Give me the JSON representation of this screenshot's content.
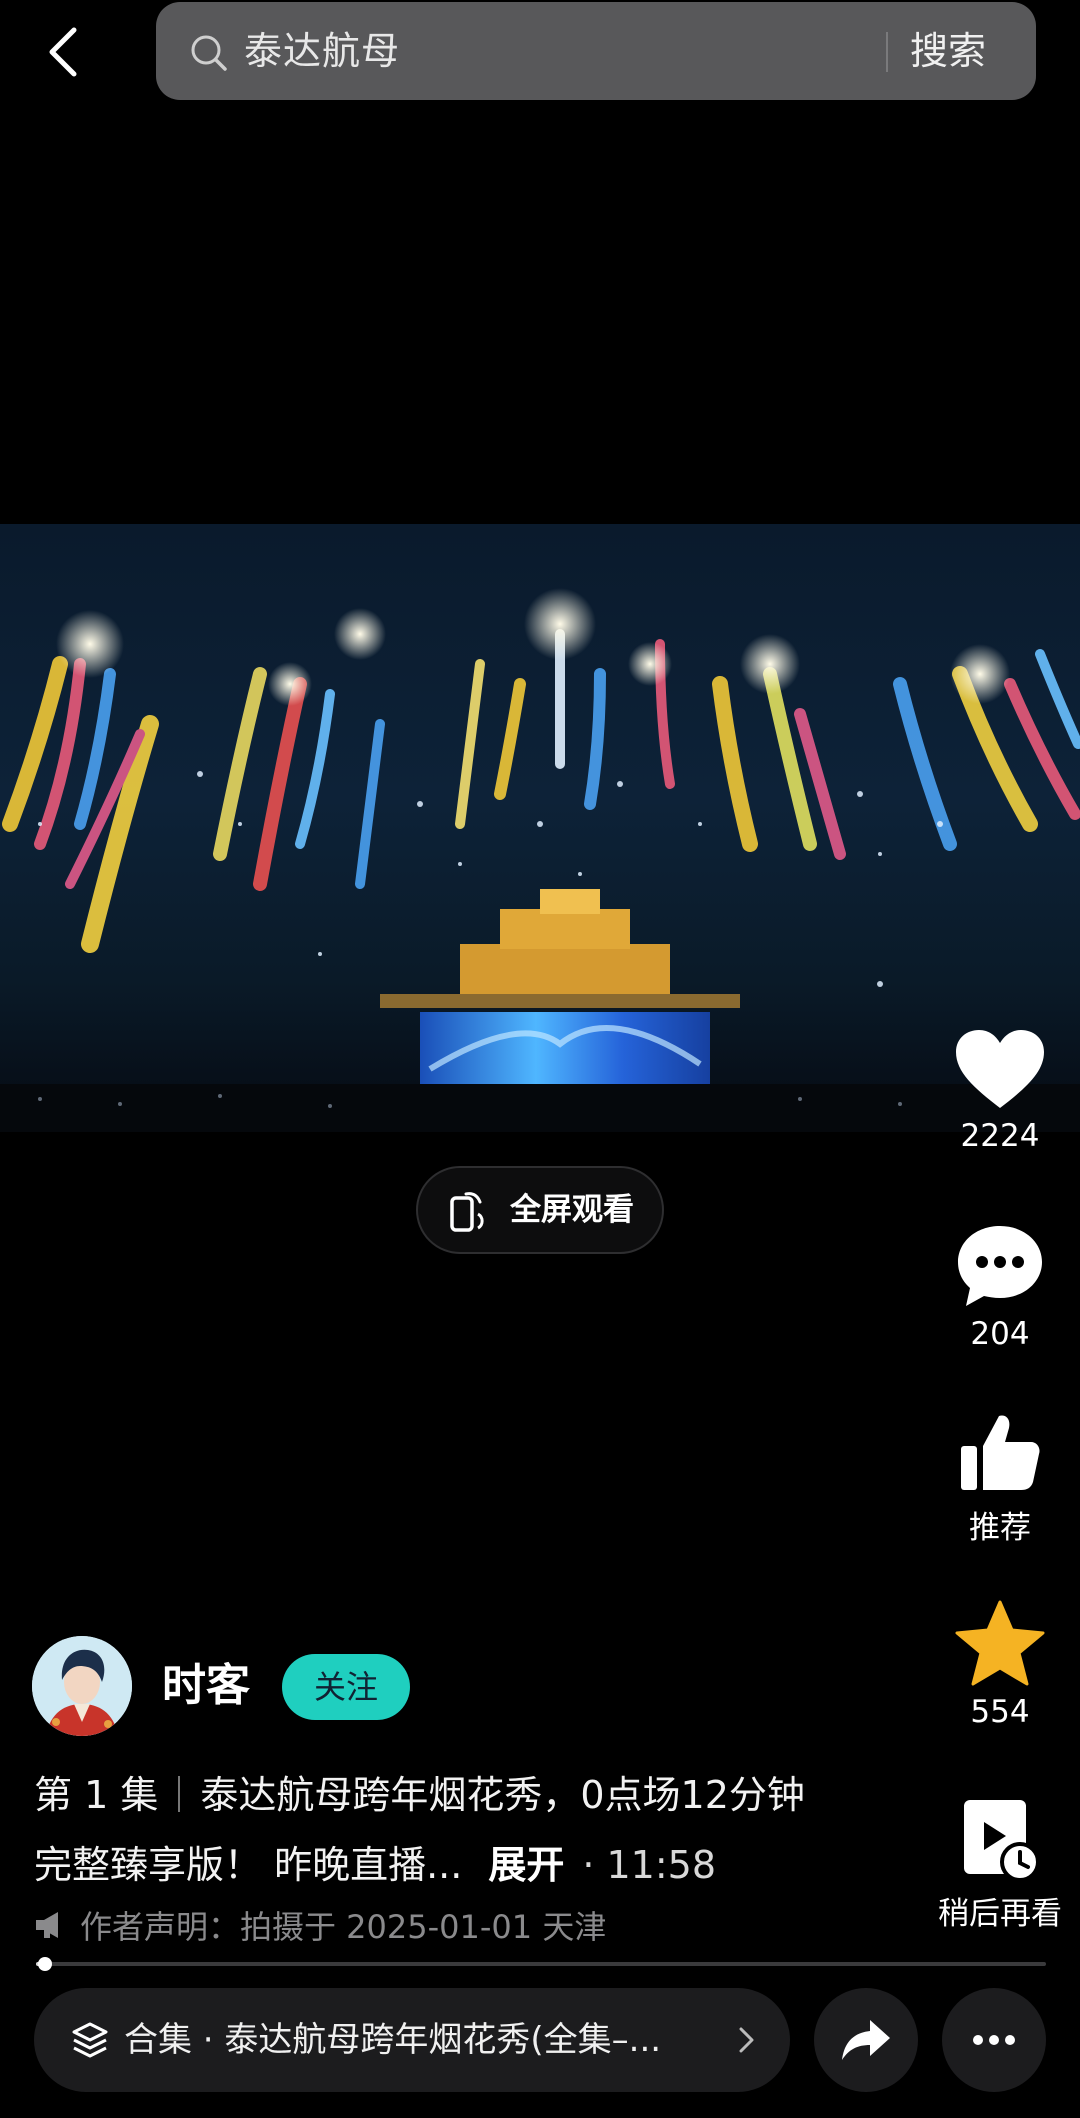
{
  "search": {
    "query": "泰达航母",
    "button_label": "搜索"
  },
  "video": {
    "fullscreen_label": "全屏观看"
  },
  "actions": {
    "like_count": "2224",
    "comment_count": "204",
    "recommend_label": "推荐",
    "favorite_count": "554",
    "watch_later_label": "稍后再看"
  },
  "author": {
    "name": "时客",
    "follow_label": "关注"
  },
  "description": {
    "episode": "第 1 集",
    "text": "泰达航母跨年烟花秀，0点场12分钟完整臻享版！ 昨晚直播...",
    "expand_label": "展开",
    "duration": "· 11:58"
  },
  "statement": "作者声明：拍摄于 2025-01-01 天津",
  "playback": {
    "progress": 0.005
  },
  "collection": {
    "label": "合集 · 泰达航母跨年烟花秀(全集–..."
  },
  "colors": {
    "accent": "#1fcfbf",
    "favorite": "#f5b323",
    "background": "#000000"
  },
  "icons": [
    "back-arrow-icon",
    "search-icon",
    "heart-icon",
    "comment-icon",
    "thumbs-up-icon",
    "star-icon",
    "watch-later-icon",
    "fullscreen-rotate-icon",
    "megaphone-icon",
    "layers-icon",
    "chevron-right-icon",
    "share-icon",
    "more-icon"
  ]
}
